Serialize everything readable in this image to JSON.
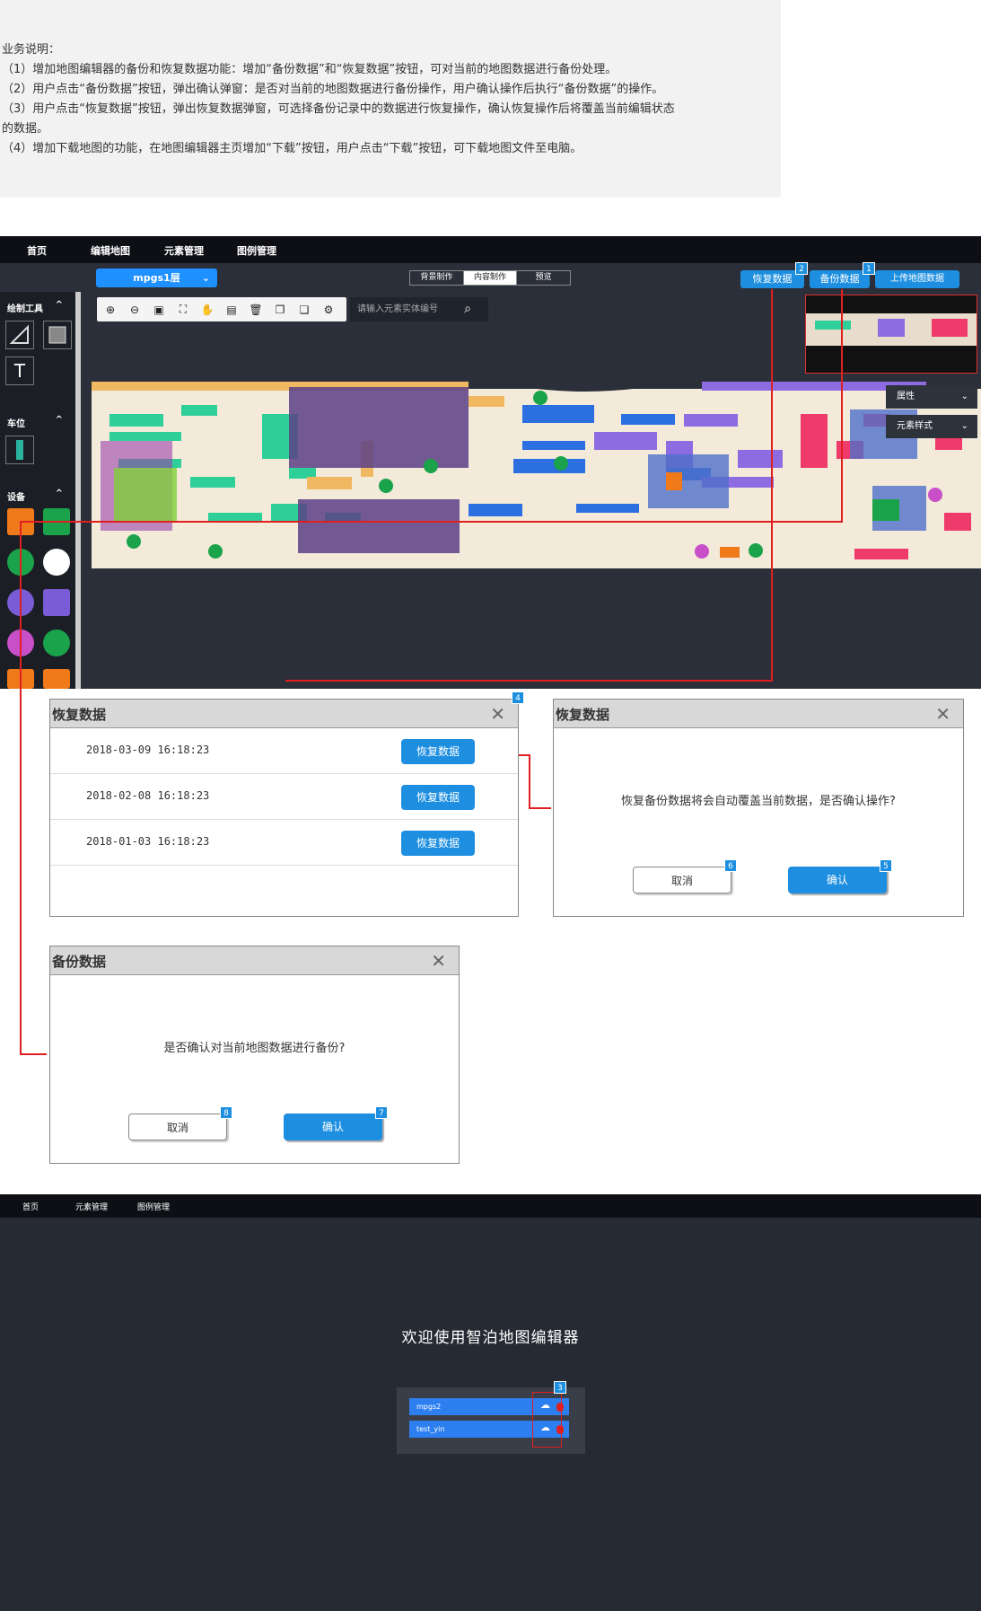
{
  "notes": {
    "title": "业务说明：",
    "lines": [
      "（1）增加地图编辑器的备份和恢复数据功能：增加“备份数据”和“恢复数据”按钮，可对当前的地图数据进行备份处理。",
      "（2）用户点击“备份数据”按钮，弹出确认弹窗：是否对当前的地图数据进行备份操作，用户确认操作后执行“备份数据”的操作。",
      "（3）用户点击“恢复数据”按钮，弹出恢复数据弹窗，可选择备份记录中的数据进行恢复操作，确认恢复操作后将覆盖当前编辑状态",
      "的数据。",
      "（4）增加下载地图的功能，在地图编辑器主页增加“下载”按钮，用户点击“下载”按钮，可下载地图文件至电脑。"
    ]
  },
  "editor": {
    "nav": [
      "首页",
      "编辑地图",
      "元素管理",
      "图例管理"
    ],
    "floor": "mpgs1层",
    "modes": [
      "背景制作",
      "内容制作",
      "预览"
    ],
    "restore_btn": "恢复数据",
    "backup_btn": "备份数据",
    "upload_btn": "上传地图数据",
    "search_placeholder": "请输入元素实体编号",
    "sections": {
      "draw": "绘制工具",
      "parking": "车位",
      "device": "设备"
    },
    "props": {
      "attr": "属性",
      "style": "元素样式"
    },
    "text_tool": "T"
  },
  "restore_dialog": {
    "title": "恢复数据",
    "rows": [
      {
        "date": "2018-03-09 16:18:23",
        "btn": "恢复数据"
      },
      {
        "date": "2018-02-08 16:18:23",
        "btn": "恢复数据"
      },
      {
        "date": "2018-01-03 16:18:23",
        "btn": "恢复数据"
      }
    ]
  },
  "confirm_restore": {
    "title": "恢复数据",
    "message": "恢复备份数据将会自动覆盖当前数据，是否确认操作?",
    "cancel": "取消",
    "ok": "确认"
  },
  "backup_dialog": {
    "title": "备份数据",
    "message": "是否确认对当前地图数据进行备份?",
    "cancel": "取消",
    "ok": "确认"
  },
  "home": {
    "nav": [
      "首页",
      "元素管理",
      "图例管理"
    ],
    "welcome": "欢迎使用智泊地图编辑器",
    "maps": [
      "mpgs2",
      "test_yin"
    ]
  },
  "badges": [
    "1",
    "2",
    "3",
    "4",
    "5",
    "6",
    "7",
    "8"
  ],
  "colors": {
    "accent": "#1e8fe0",
    "annotation": "#e02020",
    "dark": "#2b2f3a"
  }
}
